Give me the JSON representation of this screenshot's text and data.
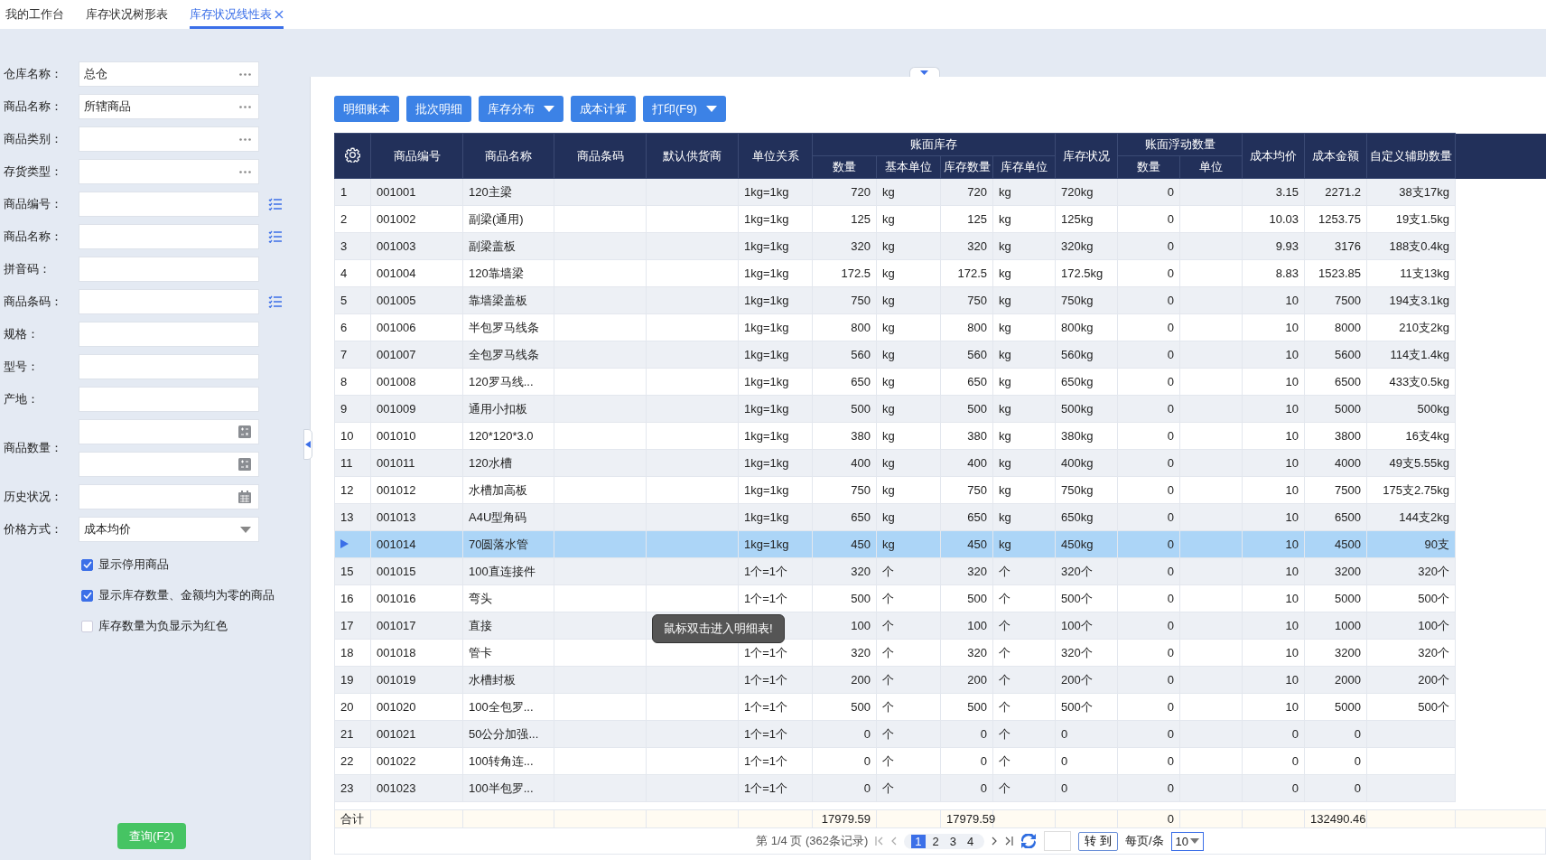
{
  "tabs": [
    {
      "label": "我的工作台",
      "selected": false,
      "closable": false
    },
    {
      "label": "库存状况树形表",
      "selected": false,
      "closable": false
    },
    {
      "label": "库存状况线性表",
      "selected": true,
      "closable": true
    }
  ],
  "filters": [
    {
      "label": "仓库名称：",
      "value": "总仓",
      "kind": "more"
    },
    {
      "label": "商品名称：",
      "value": "所辖商品",
      "kind": "more"
    },
    {
      "label": "商品类别：",
      "kind": "more"
    },
    {
      "label": "存货类型：",
      "kind": "more"
    },
    {
      "label": "商品编号：",
      "kind": "list"
    },
    {
      "label": "商品名称：",
      "kind": "list"
    },
    {
      "label": "拼音码：",
      "kind": "plain"
    },
    {
      "label": "商品条码：",
      "kind": "list"
    },
    {
      "label": "规格：",
      "kind": "plain"
    },
    {
      "label": "型号：",
      "kind": "plain"
    },
    {
      "label": "产地：",
      "kind": "plain"
    },
    {
      "label": "商品数量：",
      "kind": "range"
    },
    {
      "label": "历史状况：",
      "kind": "date"
    },
    {
      "label": "价格方式：",
      "value": "成本均价",
      "kind": "select"
    }
  ],
  "options": [
    {
      "label": "显示停用商品",
      "checked": true
    },
    {
      "label": "显示库存数量、金额均为零的商品",
      "checked": true
    },
    {
      "label": "库存数量为负显示为红色",
      "checked": false
    }
  ],
  "query_button": "查询(F2)",
  "toolbar": [
    {
      "label": "明细账本",
      "dropdown": false
    },
    {
      "label": "批次明细",
      "dropdown": false
    },
    {
      "label": "库存分布",
      "dropdown": true
    },
    {
      "label": "成本计算",
      "dropdown": false
    },
    {
      "label": "打印(F9)",
      "dropdown": true
    }
  ],
  "table": {
    "columns": [
      {
        "kind": "settings"
      },
      {
        "label": "商品编号"
      },
      {
        "label": "商品名称"
      },
      {
        "label": "商品条码"
      },
      {
        "label": "默认供货商"
      },
      {
        "label": "单位关系"
      },
      {
        "label": "账面库存",
        "children": [
          "数量",
          "基本单位",
          "库存数量",
          "库存单位"
        ]
      },
      {
        "label": "库存状况"
      },
      {
        "label": "账面浮动数量",
        "children": [
          "数量",
          "单位"
        ]
      },
      {
        "label": "成本均价"
      },
      {
        "label": "成本金额"
      },
      {
        "label": "自定义辅助数量"
      }
    ],
    "rows": [
      {
        "selected": false,
        "no": "1",
        "code": "001001",
        "name": "120主梁",
        "unit": "1kg=1kg",
        "qty": "720",
        "base_unit": "kg",
        "stock_qty": "720",
        "stock_unit": "kg",
        "status": "720kg",
        "float_qty": "0",
        "avg_cost": "3.15",
        "amount": "2271.2",
        "aux": "38支17kg"
      },
      {
        "selected": false,
        "no": "2",
        "code": "001002",
        "name": "副梁(通用)",
        "unit": "1kg=1kg",
        "qty": "125",
        "base_unit": "kg",
        "stock_qty": "125",
        "stock_unit": "kg",
        "status": "125kg",
        "float_qty": "0",
        "avg_cost": "10.03",
        "amount": "1253.75",
        "aux": "19支1.5kg"
      },
      {
        "selected": false,
        "no": "3",
        "code": "001003",
        "name": "副梁盖板",
        "unit": "1kg=1kg",
        "qty": "320",
        "base_unit": "kg",
        "stock_qty": "320",
        "stock_unit": "kg",
        "status": "320kg",
        "float_qty": "0",
        "avg_cost": "9.93",
        "amount": "3176",
        "aux": "188支0.4kg"
      },
      {
        "selected": false,
        "no": "4",
        "code": "001004",
        "name": "120靠墙梁",
        "unit": "1kg=1kg",
        "qty": "172.5",
        "base_unit": "kg",
        "stock_qty": "172.5",
        "stock_unit": "kg",
        "status": "172.5kg",
        "float_qty": "0",
        "avg_cost": "8.83",
        "amount": "1523.85",
        "aux": "11支13kg"
      },
      {
        "selected": false,
        "no": "5",
        "code": "001005",
        "name": "靠墙梁盖板",
        "unit": "1kg=1kg",
        "qty": "750",
        "base_unit": "kg",
        "stock_qty": "750",
        "stock_unit": "kg",
        "status": "750kg",
        "float_qty": "0",
        "avg_cost": "10",
        "amount": "7500",
        "aux": "194支3.1kg"
      },
      {
        "selected": false,
        "no": "6",
        "code": "001006",
        "name": "半包罗马线条",
        "unit": "1kg=1kg",
        "qty": "800",
        "base_unit": "kg",
        "stock_qty": "800",
        "stock_unit": "kg",
        "status": "800kg",
        "float_qty": "0",
        "avg_cost": "10",
        "amount": "8000",
        "aux": "210支2kg"
      },
      {
        "selected": false,
        "no": "7",
        "code": "001007",
        "name": "全包罗马线条",
        "unit": "1kg=1kg",
        "qty": "560",
        "base_unit": "kg",
        "stock_qty": "560",
        "stock_unit": "kg",
        "status": "560kg",
        "float_qty": "0",
        "avg_cost": "10",
        "amount": "5600",
        "aux": "114支1.4kg"
      },
      {
        "selected": false,
        "no": "8",
        "code": "001008",
        "name": "120罗马线...",
        "unit": "1kg=1kg",
        "qty": "650",
        "base_unit": "kg",
        "stock_qty": "650",
        "stock_unit": "kg",
        "status": "650kg",
        "float_qty": "0",
        "avg_cost": "10",
        "amount": "6500",
        "aux": "433支0.5kg"
      },
      {
        "selected": false,
        "no": "9",
        "code": "001009",
        "name": "通用小扣板",
        "unit": "1kg=1kg",
        "qty": "500",
        "base_unit": "kg",
        "stock_qty": "500",
        "stock_unit": "kg",
        "status": "500kg",
        "float_qty": "0",
        "avg_cost": "10",
        "amount": "5000",
        "aux": "500kg"
      },
      {
        "selected": false,
        "no": "10",
        "code": "001010",
        "name": "120*120*3.0",
        "unit": "1kg=1kg",
        "qty": "380",
        "base_unit": "kg",
        "stock_qty": "380",
        "stock_unit": "kg",
        "status": "380kg",
        "float_qty": "0",
        "avg_cost": "10",
        "amount": "3800",
        "aux": "16支4kg"
      },
      {
        "selected": false,
        "no": "11",
        "code": "001011",
        "name": "120水槽",
        "unit": "1kg=1kg",
        "qty": "400",
        "base_unit": "kg",
        "stock_qty": "400",
        "stock_unit": "kg",
        "status": "400kg",
        "float_qty": "0",
        "avg_cost": "10",
        "amount": "4000",
        "aux": "49支5.55kg"
      },
      {
        "selected": false,
        "no": "12",
        "code": "001012",
        "name": "水槽加高板",
        "unit": "1kg=1kg",
        "qty": "750",
        "base_unit": "kg",
        "stock_qty": "750",
        "stock_unit": "kg",
        "status": "750kg",
        "float_qty": "0",
        "avg_cost": "10",
        "amount": "7500",
        "aux": "175支2.75kg"
      },
      {
        "selected": false,
        "no": "13",
        "code": "001013",
        "name": "A4U型角码",
        "unit": "1kg=1kg",
        "qty": "650",
        "base_unit": "kg",
        "stock_qty": "650",
        "stock_unit": "kg",
        "status": "650kg",
        "float_qty": "0",
        "avg_cost": "10",
        "amount": "6500",
        "aux": "144支2kg"
      },
      {
        "selected": true,
        "code": "001014",
        "name": "70圆落水管",
        "unit": "1kg=1kg",
        "qty": "450",
        "base_unit": "kg",
        "stock_qty": "450",
        "stock_unit": "kg",
        "status": "450kg",
        "float_qty": "0",
        "avg_cost": "10",
        "amount": "4500",
        "aux": "90支"
      },
      {
        "selected": false,
        "no": "15",
        "code": "001015",
        "name": "100直连接件",
        "unit": "1个=1个",
        "qty": "320",
        "base_unit": "个",
        "stock_qty": "320",
        "stock_unit": "个",
        "status": "320个",
        "float_qty": "0",
        "avg_cost": "10",
        "amount": "3200",
        "aux": "320个"
      },
      {
        "selected": false,
        "no": "16",
        "code": "001016",
        "name": "弯头",
        "unit": "1个=1个",
        "qty": "500",
        "base_unit": "个",
        "stock_qty": "500",
        "stock_unit": "个",
        "status": "500个",
        "float_qty": "0",
        "avg_cost": "10",
        "amount": "5000",
        "aux": "500个"
      },
      {
        "selected": false,
        "no": "17",
        "code": "001017",
        "name": "直接",
        "qty": "100",
        "base_unit": "个",
        "stock_qty": "100",
        "stock_unit": "个",
        "status": "100个",
        "float_qty": "0",
        "avg_cost": "10",
        "amount": "1000",
        "aux": "100个"
      },
      {
        "selected": false,
        "no": "18",
        "code": "001018",
        "name": "管卡",
        "unit": "1个=1个",
        "qty": "320",
        "base_unit": "个",
        "stock_qty": "320",
        "stock_unit": "个",
        "status": "320个",
        "float_qty": "0",
        "avg_cost": "10",
        "amount": "3200",
        "aux": "320个"
      },
      {
        "selected": false,
        "no": "19",
        "code": "001019",
        "name": "水槽封板",
        "unit": "1个=1个",
        "qty": "200",
        "base_unit": "个",
        "stock_qty": "200",
        "stock_unit": "个",
        "status": "200个",
        "float_qty": "0",
        "avg_cost": "10",
        "amount": "2000",
        "aux": "200个"
      },
      {
        "selected": false,
        "no": "20",
        "code": "001020",
        "name": "100全包罗...",
        "unit": "1个=1个",
        "qty": "500",
        "base_unit": "个",
        "stock_qty": "500",
        "stock_unit": "个",
        "status": "500个",
        "float_qty": "0",
        "avg_cost": "10",
        "amount": "5000",
        "aux": "500个"
      },
      {
        "selected": false,
        "no": "21",
        "code": "001021",
        "name": "50公分加强...",
        "unit": "1个=1个",
        "qty": "0",
        "base_unit": "个",
        "stock_qty": "0",
        "stock_unit": "个",
        "status": "0",
        "float_qty": "0",
        "avg_cost": "0",
        "amount": "0"
      },
      {
        "selected": false,
        "no": "22",
        "code": "001022",
        "name": "100转角连...",
        "unit": "1个=1个",
        "qty": "0",
        "base_unit": "个",
        "stock_qty": "0",
        "stock_unit": "个",
        "status": "0",
        "float_qty": "0",
        "avg_cost": "0",
        "amount": "0"
      },
      {
        "selected": false,
        "no": "23",
        "code": "001023",
        "name": "100半包罗...",
        "unit": "1个=1个",
        "qty": "0",
        "base_unit": "个",
        "stock_qty": "0",
        "stock_unit": "个",
        "status": "0",
        "float_qty": "0",
        "avg_cost": "0",
        "amount": "0"
      }
    ],
    "totals": {
      "label": "合计",
      "qty": "17979.59",
      "stock_qty": "17979.59",
      "float_qty": "0",
      "amount": "132490.46"
    },
    "tooltip": "鼠标双击进入明细表!"
  },
  "pagination": {
    "summary": "第 1/4 页 (362条记录)",
    "pages": [
      {
        "label": "1",
        "selected": true
      },
      {
        "label": "2",
        "selected": false
      },
      {
        "label": "3",
        "selected": false
      },
      {
        "label": "4",
        "selected": false
      }
    ],
    "goto_button": "转 到",
    "per_page_label": "每页/条",
    "per_page": "10"
  }
}
